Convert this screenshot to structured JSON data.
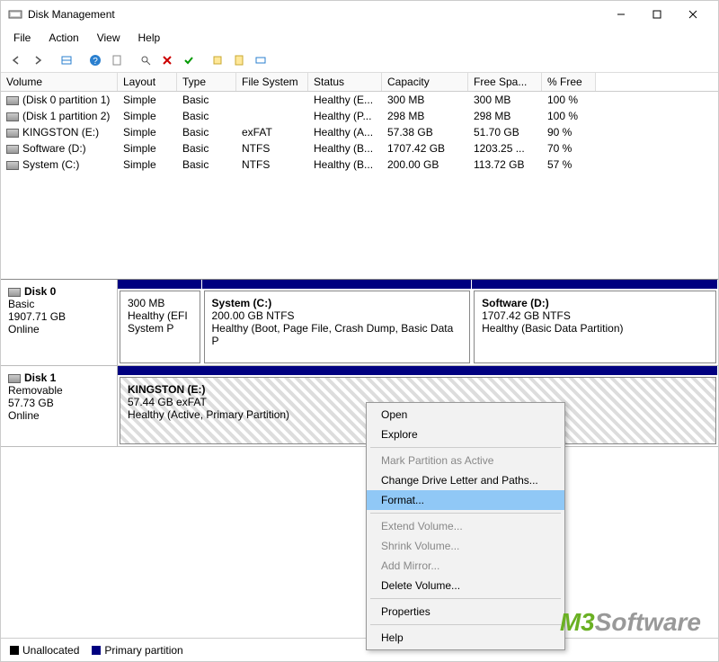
{
  "title": "Disk Management",
  "menu": [
    "File",
    "Action",
    "View",
    "Help"
  ],
  "toolbar_icons": [
    "back",
    "forward",
    "panel",
    "help",
    "sheet",
    "search",
    "delete",
    "check",
    "new",
    "doc",
    "props"
  ],
  "columns": [
    "Volume",
    "Layout",
    "Type",
    "File System",
    "Status",
    "Capacity",
    "Free Spa...",
    "% Free"
  ],
  "volumes": [
    {
      "name": "(Disk 0 partition 1)",
      "layout": "Simple",
      "type": "Basic",
      "fs": "",
      "status": "Healthy (E...",
      "cap": "300 MB",
      "free": "300 MB",
      "pct": "100 %"
    },
    {
      "name": "(Disk 1 partition 2)",
      "layout": "Simple",
      "type": "Basic",
      "fs": "",
      "status": "Healthy (P...",
      "cap": "298 MB",
      "free": "298 MB",
      "pct": "100 %"
    },
    {
      "name": "KINGSTON (E:)",
      "layout": "Simple",
      "type": "Basic",
      "fs": "exFAT",
      "status": "Healthy (A...",
      "cap": "57.38 GB",
      "free": "51.70 GB",
      "pct": "90 %"
    },
    {
      "name": "Software (D:)",
      "layout": "Simple",
      "type": "Basic",
      "fs": "NTFS",
      "status": "Healthy (B...",
      "cap": "1707.42 GB",
      "free": "1203.25 ...",
      "pct": "70 %"
    },
    {
      "name": "System (C:)",
      "layout": "Simple",
      "type": "Basic",
      "fs": "NTFS",
      "status": "Healthy (B...",
      "cap": "200.00 GB",
      "free": "113.72 GB",
      "pct": "57 %"
    }
  ],
  "disks": [
    {
      "name": "Disk 0",
      "type": "Basic",
      "size": "1907.71 GB",
      "status": "Online",
      "parts": [
        {
          "title": "",
          "sub": "300 MB",
          "status": "Healthy (EFI System P",
          "w": 14
        },
        {
          "title": "System  (C:)",
          "sub": "200.00 GB NTFS",
          "status": "Healthy (Boot, Page File, Crash Dump, Basic Data P",
          "w": 45
        },
        {
          "title": "Software  (D:)",
          "sub": "1707.42 GB NTFS",
          "status": "Healthy (Basic Data Partition)",
          "w": 41
        }
      ]
    },
    {
      "name": "Disk 1",
      "type": "Removable",
      "size": "57.73 GB",
      "status": "Online",
      "parts": [
        {
          "title": "KINGSTON  (E:)",
          "sub": "57.44 GB exFAT",
          "status": "Healthy (Active, Primary Partition)",
          "w": 100,
          "hatched": true
        }
      ]
    }
  ],
  "legend": {
    "unalloc": "Unallocated",
    "primary": "Primary partition"
  },
  "ctx": [
    {
      "label": "Open",
      "type": "item"
    },
    {
      "label": "Explore",
      "type": "item"
    },
    {
      "type": "sep"
    },
    {
      "label": "Mark Partition as Active",
      "type": "disabled"
    },
    {
      "label": "Change Drive Letter and Paths...",
      "type": "item"
    },
    {
      "label": "Format...",
      "type": "hover"
    },
    {
      "type": "sep"
    },
    {
      "label": "Extend Volume...",
      "type": "disabled"
    },
    {
      "label": "Shrink Volume...",
      "type": "disabled"
    },
    {
      "label": "Add Mirror...",
      "type": "disabled"
    },
    {
      "label": "Delete Volume...",
      "type": "item"
    },
    {
      "type": "sep"
    },
    {
      "label": "Properties",
      "type": "item"
    },
    {
      "type": "sep"
    },
    {
      "label": "Help",
      "type": "item"
    }
  ],
  "watermark": {
    "brand": "M3",
    "text": "Software"
  }
}
